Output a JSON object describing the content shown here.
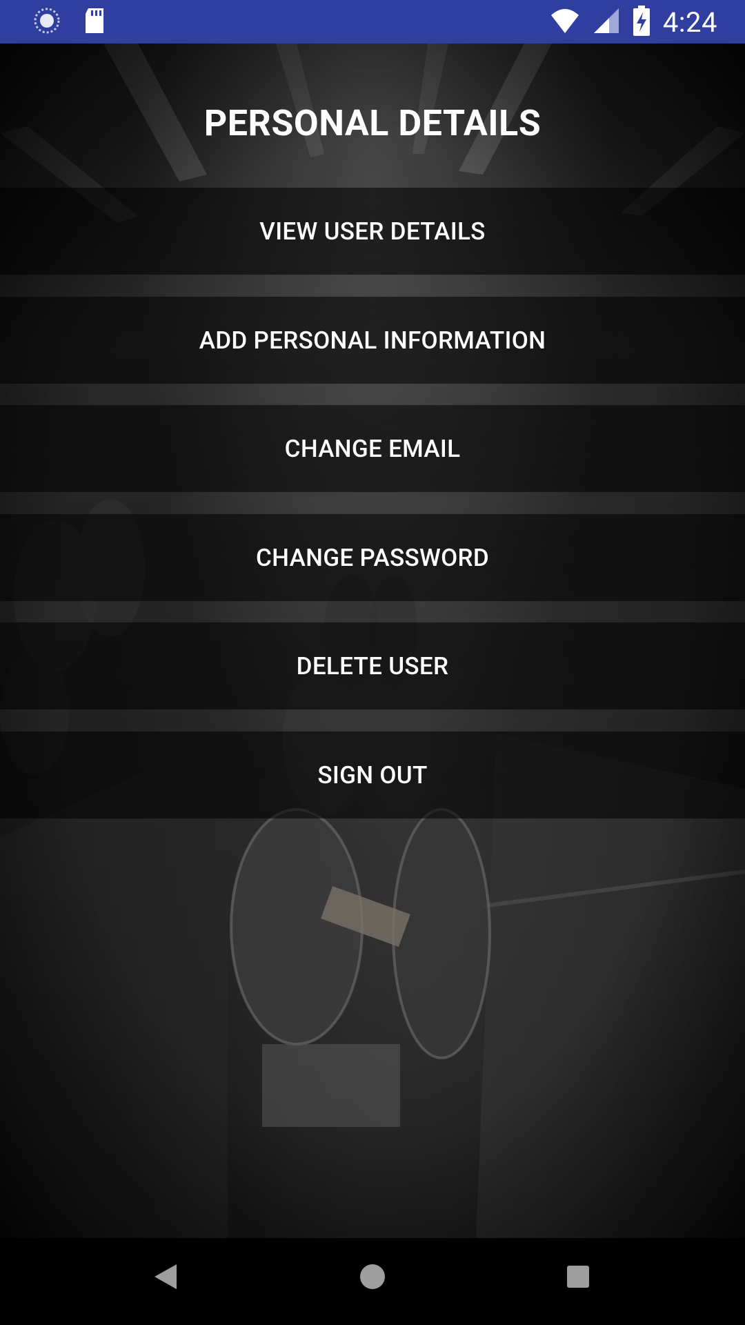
{
  "status_bar": {
    "time": "4:24",
    "left_icons": [
      "sync-icon",
      "sd-card-icon"
    ],
    "right_icons": [
      "wifi-icon",
      "cell-signal-icon",
      "battery-charging-icon"
    ],
    "background_color": "#303f9f"
  },
  "page": {
    "title": "PERSONAL DETAILS"
  },
  "menu": {
    "items": [
      {
        "label": "VIEW USER DETAILS"
      },
      {
        "label": "ADD PERSONAL INFORMATION"
      },
      {
        "label": "CHANGE EMAIL"
      },
      {
        "label": "CHANGE PASSWORD"
      },
      {
        "label": "DELETE USER"
      },
      {
        "label": "SIGN OUT"
      }
    ]
  },
  "nav_bar": {
    "icons": [
      "back-icon",
      "home-icon",
      "recents-icon"
    ]
  }
}
